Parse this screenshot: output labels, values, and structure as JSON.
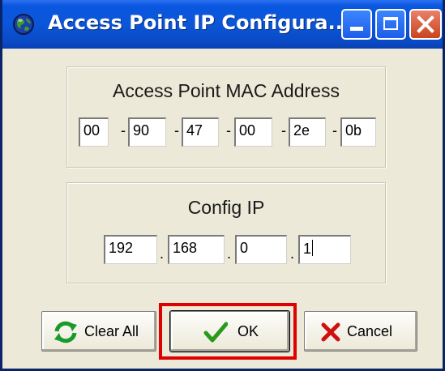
{
  "window": {
    "title": "Access Point IP Configura...",
    "controls": {
      "minimize": "minimize-icon",
      "maximize": "maximize-icon",
      "close": "close-icon"
    },
    "accent": "#0a57e0"
  },
  "mac_group": {
    "label": "Access Point MAC Address",
    "octets": [
      "00",
      "90",
      "47",
      "00",
      "2e",
      "0b"
    ],
    "separator": "-"
  },
  "ip_group": {
    "label": "Config IP",
    "octets": [
      "192",
      "168",
      "0",
      "1"
    ],
    "separator": "."
  },
  "buttons": {
    "clear_all": {
      "label": "Clear All",
      "icon": "refresh-icon"
    },
    "ok": {
      "label": "OK",
      "icon": "checkmark-icon"
    },
    "cancel": {
      "label": "Cancel",
      "icon": "x-icon"
    }
  },
  "highlight": {
    "target": "ok-button",
    "color": "#e00000"
  }
}
